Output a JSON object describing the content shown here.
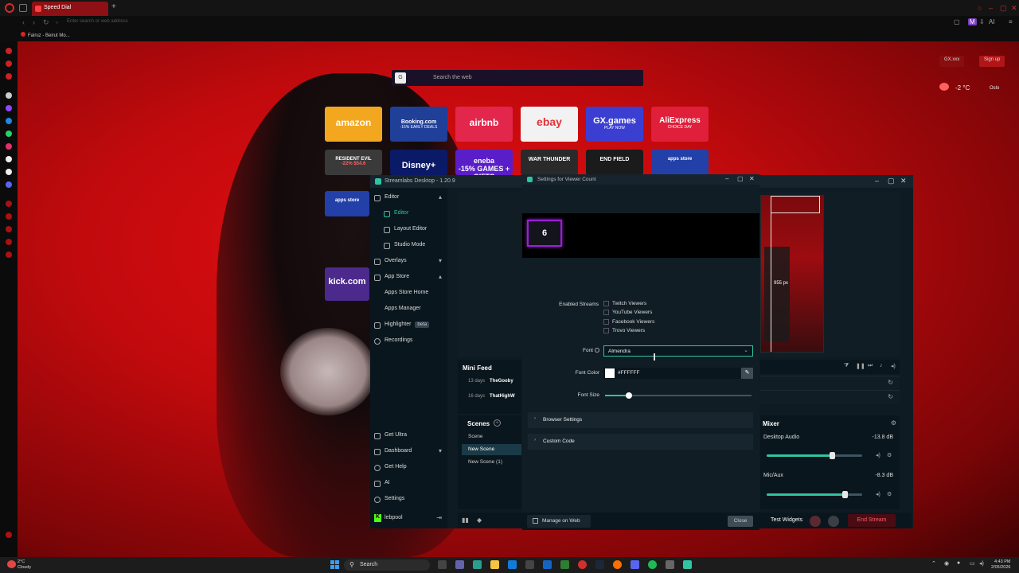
{
  "browser": {
    "active_tab": "Speed Dial",
    "address_placeholder": "Enter search or web address",
    "bookmark": "Fairuz - Beirut Mo...",
    "profile_initial": "M",
    "ai_label": "AI"
  },
  "speed_dial": {
    "search_placeholder": "Search the web",
    "search_logo": "G",
    "row1": [
      {
        "label": "amazon",
        "sub": "",
        "color": "#f3a71f"
      },
      {
        "label": "Booking.com",
        "sub": "-15% EARLY DEALS",
        "color": "#1f3f99"
      },
      {
        "label": "airbnb",
        "sub": "",
        "color": "#e2264c"
      },
      {
        "label": "ebay",
        "sub": "",
        "color": "#f2f2f2"
      },
      {
        "label": "GX.games",
        "sub": "PLAY NOW",
        "color": "#3b3fd1"
      },
      {
        "label": "AliExpress",
        "sub": "CHOICE DAY",
        "color": "#e01f3a"
      }
    ],
    "row2": [
      {
        "label": "RESIDENT EVIL",
        "sub": "-22% $54.6",
        "color": "#3a3a3a"
      },
      {
        "label": "Disney+",
        "sub": "",
        "color": "#0b1a66"
      },
      {
        "label": "eneba",
        "sub": "-15% GAMES + GIFTS",
        "color": "#5a1ec9"
      },
      {
        "label": "WAR THUNDER",
        "sub": "",
        "color": "#2a2a2a"
      },
      {
        "label": "END FIELD",
        "sub": "",
        "color": "#1b1b1b"
      },
      {
        "label": "apps store",
        "sub": "",
        "color": "#2340a8"
      }
    ],
    "row3": [
      {
        "label": "apps store",
        "color": "#2340a8"
      },
      {
        "label": "kick.com",
        "color": "#4b2a8c"
      }
    ],
    "gx_button": "GX.xxx",
    "signup": "Sign up",
    "temp": "-2 °C",
    "location": "Oslo"
  },
  "streamlabs": {
    "title": "Streamlabs Desktop - 1.20.9",
    "nav": [
      {
        "label": "Editor",
        "icon": "editor-icon",
        "sub": false,
        "chevron": "▴"
      },
      {
        "label": "Editor",
        "icon": "editor-icon",
        "sub": true,
        "selected": true
      },
      {
        "label": "Layout Editor",
        "icon": "layout-icon",
        "sub": true
      },
      {
        "label": "Studio Mode",
        "icon": "studio-icon",
        "sub": true
      },
      {
        "label": "Overlays",
        "icon": "overlays-icon",
        "sub": false,
        "chevron": "▾"
      },
      {
        "label": "App Store",
        "icon": "store-icon",
        "sub": false,
        "chevron": "▴"
      },
      {
        "label": "Apps Store Home",
        "icon": "",
        "sub": true
      },
      {
        "label": "Apps Manager",
        "icon": "",
        "sub": true
      },
      {
        "label": "Highlighter",
        "icon": "highlighter-icon",
        "sub": false,
        "badge": "beta"
      },
      {
        "label": "Recordings",
        "icon": "recordings-icon",
        "sub": false
      }
    ],
    "nav_bottom": [
      {
        "label": "Get Ultra",
        "icon": "ultra-icon"
      },
      {
        "label": "Dashboard",
        "icon": "dashboard-icon",
        "chevron": "▾"
      },
      {
        "label": "Get Help",
        "icon": "help-icon"
      },
      {
        "label": "AI",
        "icon": "ai-icon"
      },
      {
        "label": "Settings",
        "icon": "settings-icon"
      }
    ],
    "user": {
      "initial": "K",
      "name": "lebpool"
    },
    "dimension_label": "955 px",
    "mini_feed": {
      "title": "Mini Feed",
      "rows": [
        {
          "age": "13 days",
          "name": "TheGooby"
        },
        {
          "age": "16 days",
          "name": "ThatHighW"
        }
      ]
    },
    "scenes": {
      "title": "Scenes",
      "items": [
        {
          "label": "Scene",
          "active": false
        },
        {
          "label": "New Scene",
          "active": true
        },
        {
          "label": "New Scene (1)",
          "active": false
        }
      ]
    },
    "mixer": {
      "title": "Mixer",
      "tracks": [
        {
          "name": "Desktop Audio",
          "db": "-13.8 dB",
          "level": 0.68
        },
        {
          "name": "Mic/Aux",
          "db": "-8.3 dB",
          "level": 0.82
        }
      ]
    },
    "test_widgets": "Test Widgets",
    "end_stream": "End Stream"
  },
  "dialog": {
    "title": "Settings for Viewer Count",
    "viewer_count": "6",
    "enabled_streams_label": "Enabled Streams",
    "streams": [
      "Twitch Viewers",
      "YouTube Viewers",
      "Facebook Viewers",
      "Trovo Viewers"
    ],
    "font_label": "Font",
    "font_value": "Almendra",
    "font_color_label": "Font Color",
    "font_color_value": "#FFFFFF",
    "font_size_label": "Font Size",
    "font_size_level": 0.17,
    "sections": [
      "Browser Settings",
      "Custom Code"
    ],
    "manage_label": "Manage on Web",
    "close_label": "Close",
    "accent": "#31c3a2",
    "count_border": "#9b1fd6"
  },
  "taskbar": {
    "temp": "2°C",
    "condition": "Cloudy",
    "search": "Search",
    "time": "4:43 PM",
    "date": "2/05/2026"
  }
}
